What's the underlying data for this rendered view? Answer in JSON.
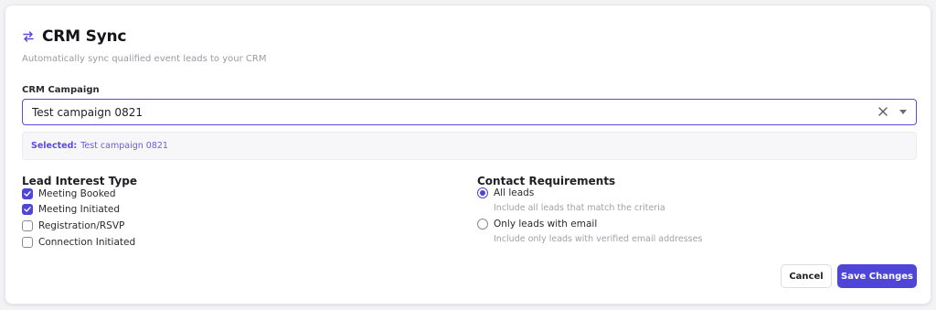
{
  "header": {
    "title": "CRM Sync",
    "subtitle": "Automatically sync qualified event leads to your CRM",
    "icon": "sync-arrows-icon"
  },
  "campaign": {
    "label": "CRM Campaign",
    "value": "Test campaign 0821",
    "selected_key": "Selected:",
    "selected_value": "Test campaign 0821"
  },
  "lead_interest": {
    "title": "Lead Interest Type",
    "options": [
      {
        "label": "Meeting Booked",
        "checked": true
      },
      {
        "label": "Meeting Initiated",
        "checked": true
      },
      {
        "label": "Registration/RSVP",
        "checked": false
      },
      {
        "label": "Connection Initiated",
        "checked": false
      }
    ]
  },
  "contact_requirements": {
    "title": "Contact Requirements",
    "options": [
      {
        "label": "All leads",
        "description": "Include all leads that match the criteria",
        "selected": true
      },
      {
        "label": "Only leads with email",
        "description": "Include only leads with verified email addresses",
        "selected": false
      }
    ]
  },
  "actions": {
    "cancel_label": "Cancel",
    "save_label": "Save Changes"
  },
  "colors": {
    "accent": "#4f46d8",
    "muted_text": "#9a9aa5"
  }
}
